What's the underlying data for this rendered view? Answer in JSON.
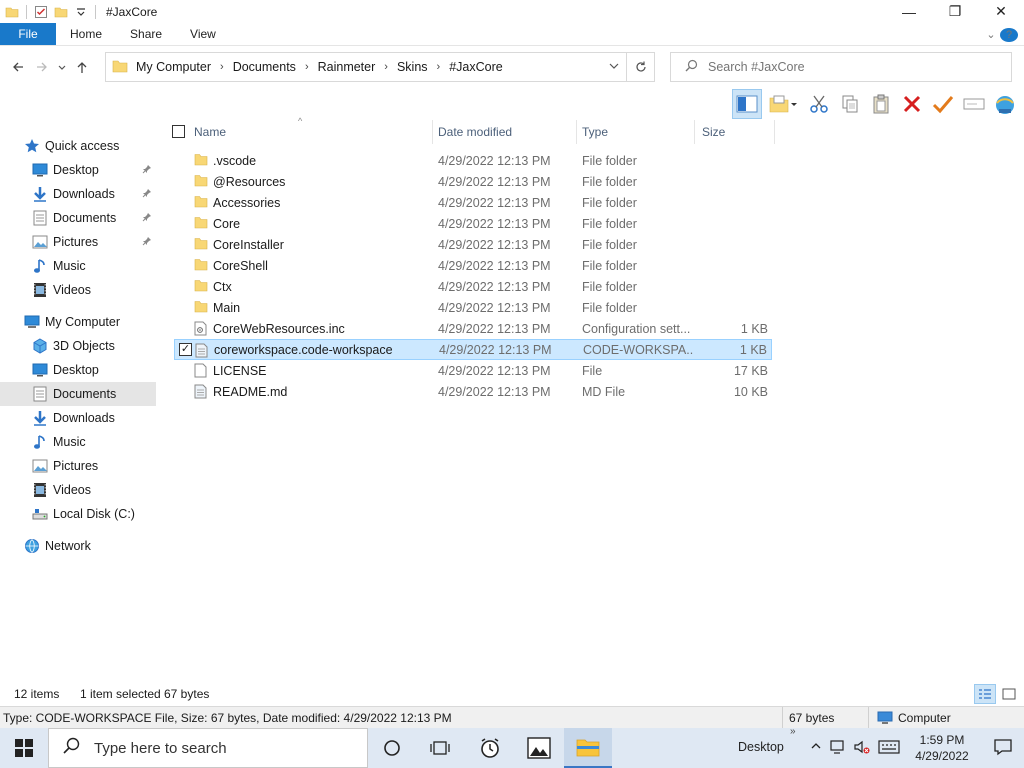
{
  "window": {
    "title": "#JaxCore",
    "controls": {
      "minimize": "—",
      "maximize": "❐",
      "close": "✕"
    }
  },
  "ribbon": {
    "tabs": [
      {
        "label": "File"
      },
      {
        "label": "Home"
      },
      {
        "label": "Share"
      },
      {
        "label": "View"
      }
    ]
  },
  "address": {
    "breadcrumbs": [
      "My Computer",
      "Documents",
      "Rainmeter",
      "Skins",
      "#JaxCore"
    ],
    "search_placeholder": "Search #JaxCore"
  },
  "navpane": {
    "items": [
      {
        "label": "Quick access",
        "icon": "star-icon",
        "indent": 0,
        "pinned": false,
        "selected": false
      },
      {
        "label": "Desktop",
        "icon": "desktop-icon",
        "indent": 1,
        "pinned": true,
        "selected": false
      },
      {
        "label": "Downloads",
        "icon": "download-icon",
        "indent": 1,
        "pinned": true,
        "selected": false
      },
      {
        "label": "Documents",
        "icon": "documents-icon",
        "indent": 1,
        "pinned": true,
        "selected": false
      },
      {
        "label": "Pictures",
        "icon": "pictures-icon",
        "indent": 1,
        "pinned": true,
        "selected": false
      },
      {
        "label": "Music",
        "icon": "music-icon",
        "indent": 1,
        "pinned": false,
        "selected": false
      },
      {
        "label": "Videos",
        "icon": "videos-icon",
        "indent": 1,
        "pinned": false,
        "selected": false
      },
      {
        "label": "My Computer",
        "icon": "computer-icon",
        "indent": 0,
        "pinned": false,
        "selected": false
      },
      {
        "label": "3D Objects",
        "icon": "3d-objects-icon",
        "indent": 1,
        "pinned": false,
        "selected": false
      },
      {
        "label": "Desktop",
        "icon": "desktop-icon",
        "indent": 1,
        "pinned": false,
        "selected": false
      },
      {
        "label": "Documents",
        "icon": "documents-icon",
        "indent": 1,
        "pinned": false,
        "selected": true
      },
      {
        "label": "Downloads",
        "icon": "download-icon",
        "indent": 1,
        "pinned": false,
        "selected": false
      },
      {
        "label": "Music",
        "icon": "music-icon",
        "indent": 1,
        "pinned": false,
        "selected": false
      },
      {
        "label": "Pictures",
        "icon": "pictures-icon",
        "indent": 1,
        "pinned": false,
        "selected": false
      },
      {
        "label": "Videos",
        "icon": "videos-icon",
        "indent": 1,
        "pinned": false,
        "selected": false
      },
      {
        "label": "Local Disk (C:)",
        "icon": "drive-icon",
        "indent": 1,
        "pinned": false,
        "selected": false
      },
      {
        "label": "Network",
        "icon": "network-icon",
        "indent": 0,
        "pinned": false,
        "selected": false
      }
    ]
  },
  "filelist": {
    "columns": {
      "name": "Name",
      "date": "Date modified",
      "type": "Type",
      "size": "Size"
    },
    "rows": [
      {
        "name": ".vscode",
        "date": "4/29/2022 12:13 PM",
        "type": "File folder",
        "size": "",
        "icon": "folder-icon",
        "selected": false
      },
      {
        "name": "@Resources",
        "date": "4/29/2022 12:13 PM",
        "type": "File folder",
        "size": "",
        "icon": "folder-icon",
        "selected": false
      },
      {
        "name": "Accessories",
        "date": "4/29/2022 12:13 PM",
        "type": "File folder",
        "size": "",
        "icon": "folder-icon",
        "selected": false
      },
      {
        "name": "Core",
        "date": "4/29/2022 12:13 PM",
        "type": "File folder",
        "size": "",
        "icon": "folder-icon",
        "selected": false
      },
      {
        "name": "CoreInstaller",
        "date": "4/29/2022 12:13 PM",
        "type": "File folder",
        "size": "",
        "icon": "folder-icon",
        "selected": false
      },
      {
        "name": "CoreShell",
        "date": "4/29/2022 12:13 PM",
        "type": "File folder",
        "size": "",
        "icon": "folder-icon",
        "selected": false
      },
      {
        "name": "Ctx",
        "date": "4/29/2022 12:13 PM",
        "type": "File folder",
        "size": "",
        "icon": "folder-icon",
        "selected": false
      },
      {
        "name": "Main",
        "date": "4/29/2022 12:13 PM",
        "type": "File folder",
        "size": "",
        "icon": "folder-icon",
        "selected": false
      },
      {
        "name": "CoreWebResources.inc",
        "date": "4/29/2022 12:13 PM",
        "type": "Configuration sett...",
        "size": "1 KB",
        "icon": "config-file-icon",
        "selected": false
      },
      {
        "name": "coreworkspace.code-workspace",
        "date": "4/29/2022 12:13 PM",
        "type": "CODE-WORKSPA...",
        "size": "1 KB",
        "icon": "workspace-file-icon",
        "selected": true
      },
      {
        "name": "LICENSE",
        "date": "4/29/2022 12:13 PM",
        "type": "File",
        "size": "17 KB",
        "icon": "file-icon",
        "selected": false
      },
      {
        "name": "README.md",
        "date": "4/29/2022 12:13 PM",
        "type": "MD File",
        "size": "10 KB",
        "icon": "md-file-icon",
        "selected": false
      }
    ]
  },
  "status": {
    "item_count": "12 items",
    "selection": "1 item selected",
    "selection_size": "67 bytes"
  },
  "infobar": {
    "details": "Type: CODE-WORKSPACE File, Size: 67 bytes, Date modified: 4/29/2022 12:13 PM",
    "size": "67 bytes",
    "location": "Computer"
  },
  "taskbar": {
    "search_placeholder": "Type here to search",
    "desktop_label": "Desktop",
    "time": "1:59 PM",
    "date": "4/29/2022"
  },
  "colors": {
    "accent": "#1979ca",
    "selection_bg": "#cce8ff",
    "folder": "#f8d775"
  }
}
